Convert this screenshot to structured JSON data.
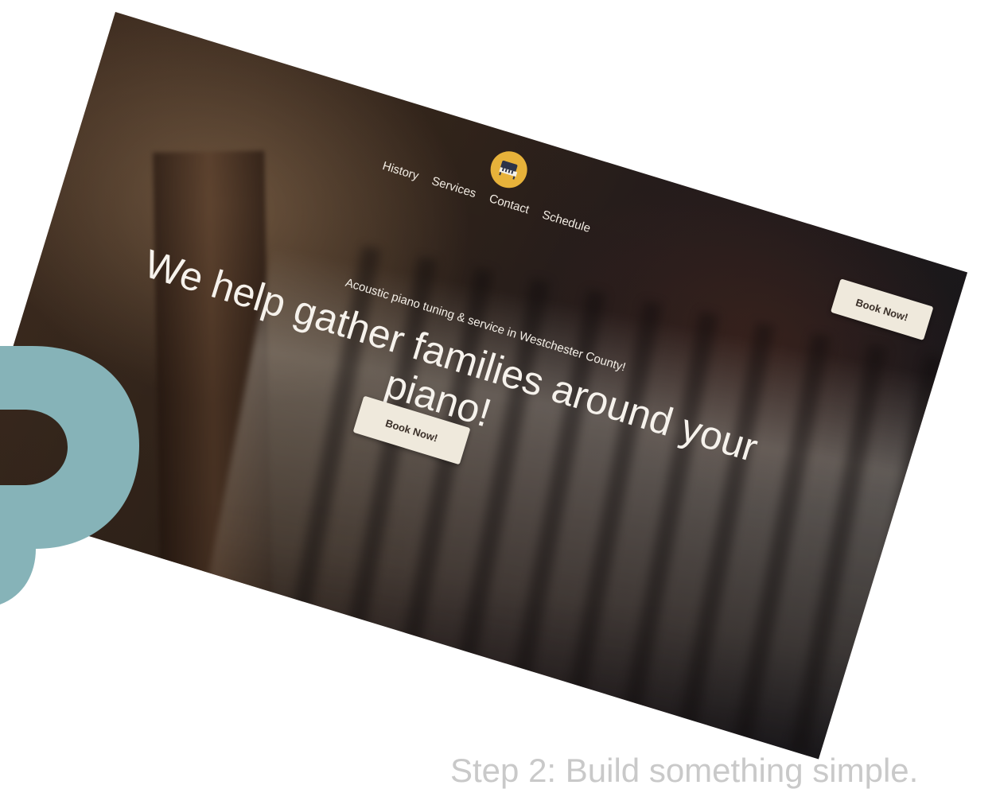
{
  "site": {
    "logo_icon": "piano-icon",
    "nav": [
      {
        "label": "History"
      },
      {
        "label": "Services"
      },
      {
        "label": "Contact"
      },
      {
        "label": "Schedule"
      }
    ],
    "header_button_label": "Book Now!",
    "tagline": "Acoustic piano tuning & service in Westchester County!",
    "headline": "We help gather families around your piano!",
    "hero_button_label": "Book Now!",
    "accent_color": "#e7b23a",
    "button_color": "#efe9dc"
  },
  "decoration": {
    "letter": "P",
    "color": "#86b3b8"
  },
  "caption": "Step 2: Build something simple."
}
